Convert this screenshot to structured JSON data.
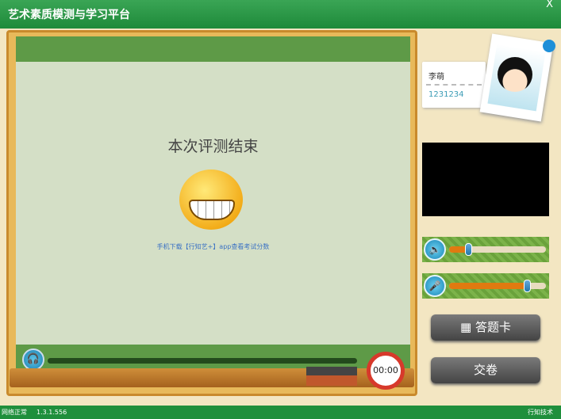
{
  "window": {
    "title": "艺术素质模测与学习平台",
    "close_label": "X"
  },
  "board": {
    "end_text": "本次评测结束",
    "hint": "手机下载【行知艺+】app查看考试分数",
    "timer": "00:00"
  },
  "user": {
    "name": "李萌",
    "id": "1231234"
  },
  "controls": {
    "answer_card_label": "答题卡",
    "submit_label": "交卷",
    "volume_level": 0.2,
    "mic_level": 0.8
  },
  "status": {
    "network": "网络正常",
    "version": "1.3.1.556",
    "brand": "行知技术"
  },
  "colors": {
    "title_green": "#1e8a3a",
    "board": "#d4dfc6",
    "slider_fill": "#e07a10"
  }
}
